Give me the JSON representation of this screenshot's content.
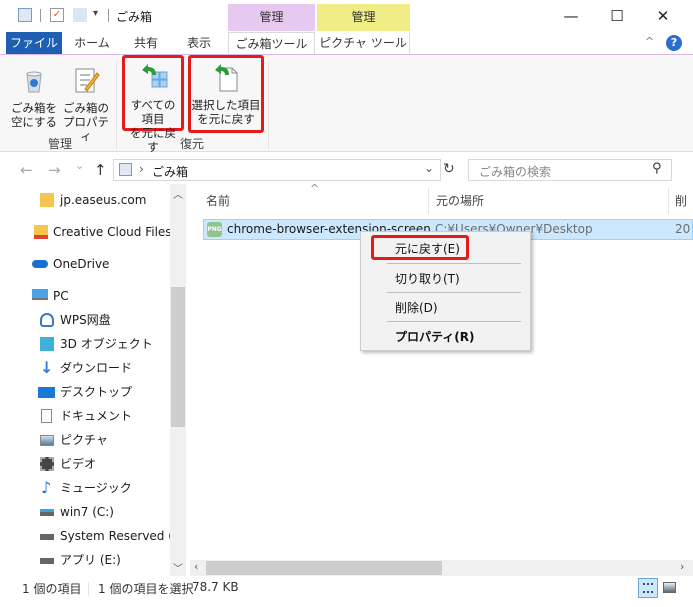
{
  "window": {
    "title": "ごみ箱",
    "quick_access": [
      "recycle-bin-icon",
      "properties-check-icon",
      "new-folder-icon",
      "customize-dropdown"
    ],
    "controls": {
      "minimize": "—",
      "maximize": "☐",
      "close": "✕"
    }
  },
  "contextual_tabs": [
    {
      "group": "管理",
      "tab": "ごみ箱ツール",
      "color": "#e7c8f0"
    },
    {
      "group": "管理",
      "tab": "ピクチャ ツール",
      "color": "#f1ed86"
    }
  ],
  "ribbon_tabs": {
    "file": "ファイル",
    "home": "ホーム",
    "share": "共有",
    "view": "表示",
    "recycle_tools": "ごみ箱ツール",
    "picture_tools": "ピクチャ ツール",
    "collapse": "^",
    "help": "?"
  },
  "ribbon": {
    "groups": [
      {
        "label": "管理",
        "buttons": [
          {
            "line1": "ごみ箱を",
            "line2": "空にする",
            "icon": "empty-recycle-bin-icon"
          },
          {
            "line1": "ごみ箱の",
            "line2": "プロパティ",
            "icon": "recycle-bin-properties-icon"
          }
        ]
      },
      {
        "label": "復元",
        "buttons": [
          {
            "line1": "すべての項目",
            "line2": "を元に戻す",
            "icon": "restore-all-icon",
            "highlighted": true
          },
          {
            "line1": "選択した項目",
            "line2": "を元に戻す",
            "icon": "restore-selected-icon",
            "highlighted": true
          }
        ]
      }
    ]
  },
  "address_bar": {
    "back": "←",
    "forward": "→",
    "recent": "⌄",
    "up": "↑",
    "separator": "›",
    "location": "ごみ箱",
    "dropdown": "⌄",
    "refresh": "↻",
    "search_placeholder": "ごみ箱の検索",
    "search_icon": "⚲"
  },
  "nav_pane": {
    "items": [
      {
        "label": "jp.easeus.com",
        "icon": "folder-icon"
      },
      {
        "label": "Creative Cloud Files",
        "icon": "creative-cloud-folder-icon"
      },
      {
        "label": "OneDrive",
        "icon": "onedrive-icon"
      },
      {
        "label": "PC",
        "icon": "pc-icon"
      },
      {
        "label": "WPS网盘",
        "icon": "wps-cloud-icon"
      },
      {
        "label": "3D オブジェクト",
        "icon": "3d-objects-icon"
      },
      {
        "label": "ダウンロード",
        "icon": "downloads-icon"
      },
      {
        "label": "デスクトップ",
        "icon": "desktop-icon"
      },
      {
        "label": "ドキュメント",
        "icon": "documents-icon"
      },
      {
        "label": "ピクチャ",
        "icon": "pictures-icon"
      },
      {
        "label": "ビデオ",
        "icon": "videos-icon"
      },
      {
        "label": "ミュージック",
        "icon": "music-icon"
      },
      {
        "label": "win7 (C:)",
        "icon": "system-drive-icon"
      },
      {
        "label": "System Reserved (D:)",
        "icon": "drive-icon"
      },
      {
        "label": "アプリ (E:)",
        "icon": "drive-icon"
      }
    ]
  },
  "file_list": {
    "columns": [
      "名前",
      "元の場所",
      "削"
    ],
    "sort_indicator": "^",
    "rows": [
      {
        "name": "chrome-browser-extension-screen",
        "original_location": "C:¥Users¥Owner¥Desktop",
        "deleted": "20",
        "icon": "png-file-icon",
        "selected": true
      }
    ]
  },
  "context_menu": {
    "items": [
      {
        "label": "元に戻す(E)",
        "highlighted": true
      },
      {
        "label": "切り取り(T)"
      },
      {
        "label": "削除(D)"
      },
      {
        "label": "プロパティ(R)",
        "bold": true
      }
    ]
  },
  "status_bar": {
    "item_count": "1 個の項目",
    "selected": "1 個の項目を選択",
    "size": "78.7 KB"
  },
  "colors": {
    "accent": "#1e5fb3",
    "selection": "#cce8ff",
    "highlight_box": "#e21c1c"
  }
}
